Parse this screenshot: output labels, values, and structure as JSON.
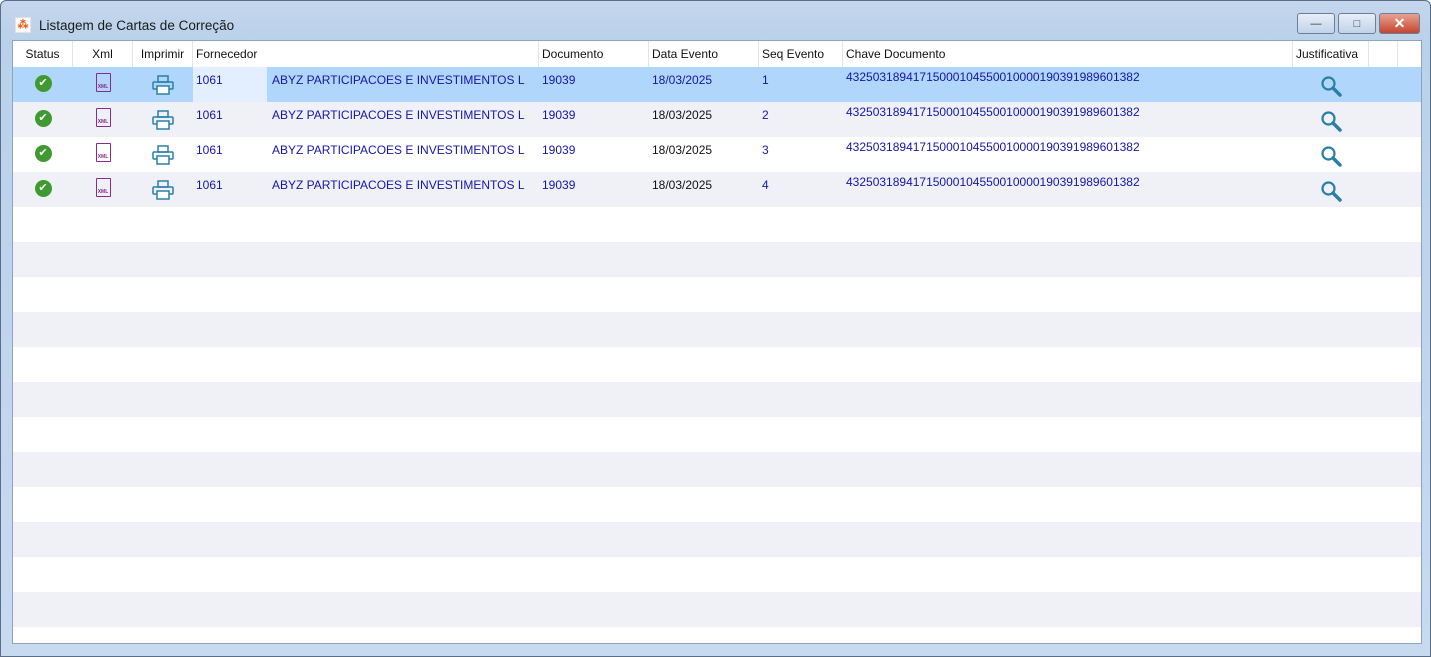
{
  "window": {
    "title": "Listagem de Cartas de Correção",
    "minimize": "—",
    "maximize": "□",
    "close": "✕"
  },
  "columns": [
    "Status",
    "Xml",
    "Imprimir",
    "Fornecedor",
    "Documento",
    "Data Evento",
    "Seq Evento",
    "Chave Documento",
    "Justificativa"
  ],
  "rows": [
    {
      "status": "ok",
      "fornecedor_code": "1061",
      "fornecedor_name": "ABYZ PARTICIPACOES E INVESTIMENTOS L",
      "documento": "19039",
      "data_evento": "18/03/2025",
      "seq_evento": "1",
      "chave": "43250318941715000104550010000190391989601382",
      "selected": true
    },
    {
      "status": "ok",
      "fornecedor_code": "1061",
      "fornecedor_name": "ABYZ PARTICIPACOES E INVESTIMENTOS L",
      "documento": "19039",
      "data_evento": "18/03/2025",
      "seq_evento": "2",
      "chave": "43250318941715000104550010000190391989601382",
      "selected": false
    },
    {
      "status": "ok",
      "fornecedor_code": "1061",
      "fornecedor_name": "ABYZ PARTICIPACOES E INVESTIMENTOS L",
      "documento": "19039",
      "data_evento": "18/03/2025",
      "seq_evento": "3",
      "chave": "43250318941715000104550010000190391989601382",
      "selected": false
    },
    {
      "status": "ok",
      "fornecedor_code": "1061",
      "fornecedor_name": "ABYZ PARTICIPACOES E INVESTIMENTOS L",
      "documento": "19039",
      "data_evento": "18/03/2025",
      "seq_evento": "4",
      "chave": "43250318941715000104550010000190391989601382",
      "selected": false
    }
  ],
  "icons": {
    "status": "check-circle-icon",
    "xml": "xml-file-icon",
    "print": "printer-icon",
    "justificativa": "magnifier-icon"
  },
  "colors": {
    "selected_row": "#b1d6fb",
    "text": "#1515a8",
    "status_ok": "#3e9a31"
  }
}
